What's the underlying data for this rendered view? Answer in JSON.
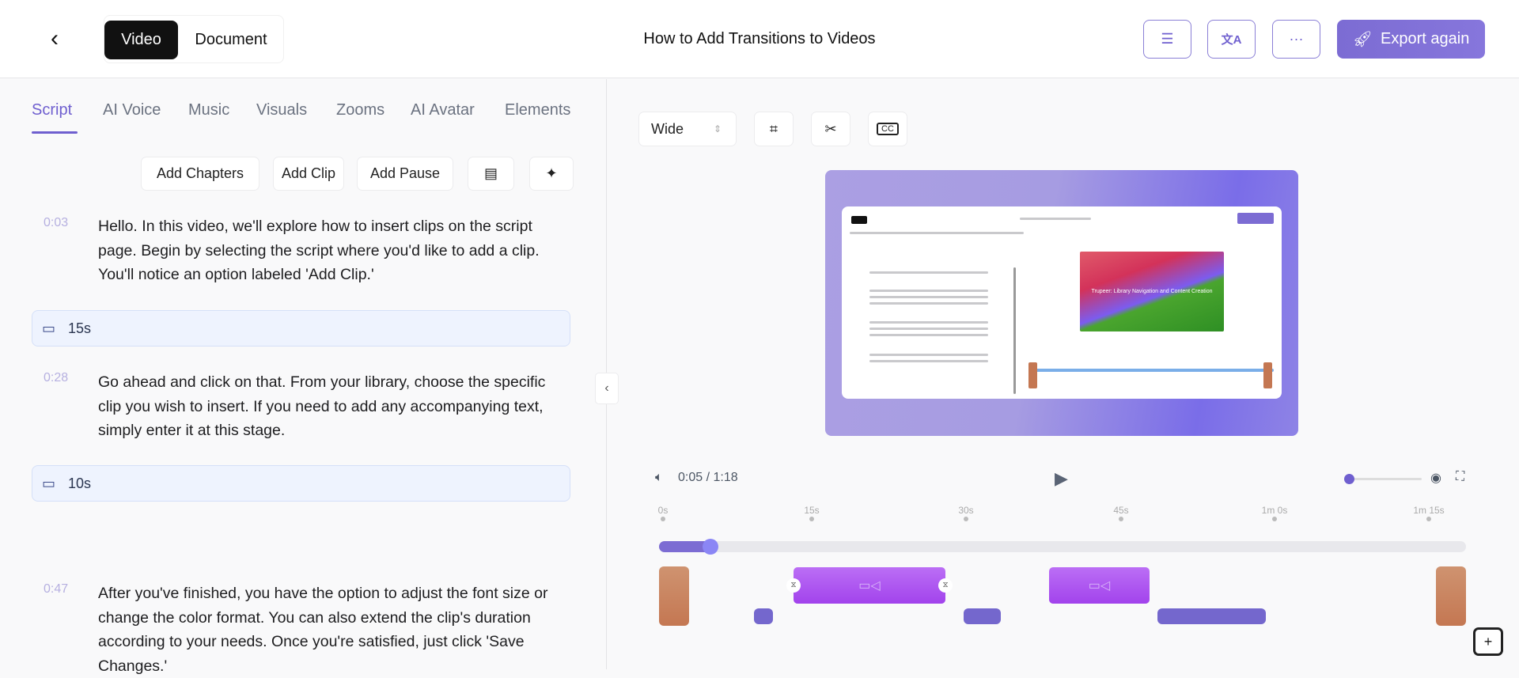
{
  "header": {
    "mode_tabs": [
      "Video",
      "Document"
    ],
    "title": "How to Add Transitions to Videos",
    "export_label": "Export again",
    "more_label": "···",
    "translate_glyph": "文A"
  },
  "left": {
    "tabs": [
      "Script",
      "AI Voice",
      "Music",
      "Visuals",
      "Zooms",
      "AI Avatar",
      "Elements"
    ],
    "actions": [
      "Add Chapters",
      "Add Clip",
      "Add Pause"
    ],
    "segments": [
      {
        "time": "0:03",
        "text": "Hello. In this video, we'll explore how to insert clips on the script page. Begin by selecting the script where you'd like to add a clip. You'll notice an option labeled 'Add Clip.'",
        "clip": "15s"
      },
      {
        "time": "0:28",
        "text": "Go ahead and click on that. From your library, choose the specific clip you wish to insert. If you need to add any accompanying text, simply enter it at this stage.",
        "clip": "10s"
      },
      {
        "time": "0:47",
        "text": "After you've finished, you have the option to adjust the font size or change the color format. You can also extend the clip's duration according to your needs. Once you're satisfied, just click 'Save Changes.'"
      }
    ]
  },
  "right": {
    "aspect": "Wide",
    "cc_label": "CC",
    "preview_title": "Trupeer: Library Navigation and Content Creation",
    "time_current": "0:05",
    "time_total": "1:18",
    "time_sep": "/",
    "progress_fraction": 0.064,
    "ruler": [
      "0s",
      "15s",
      "30s",
      "45s",
      "1m 0s",
      "1m 15s"
    ]
  },
  "colors": {
    "accent": "#6f5fcf",
    "clip": "#a243ec",
    "intro": "#c47752"
  }
}
